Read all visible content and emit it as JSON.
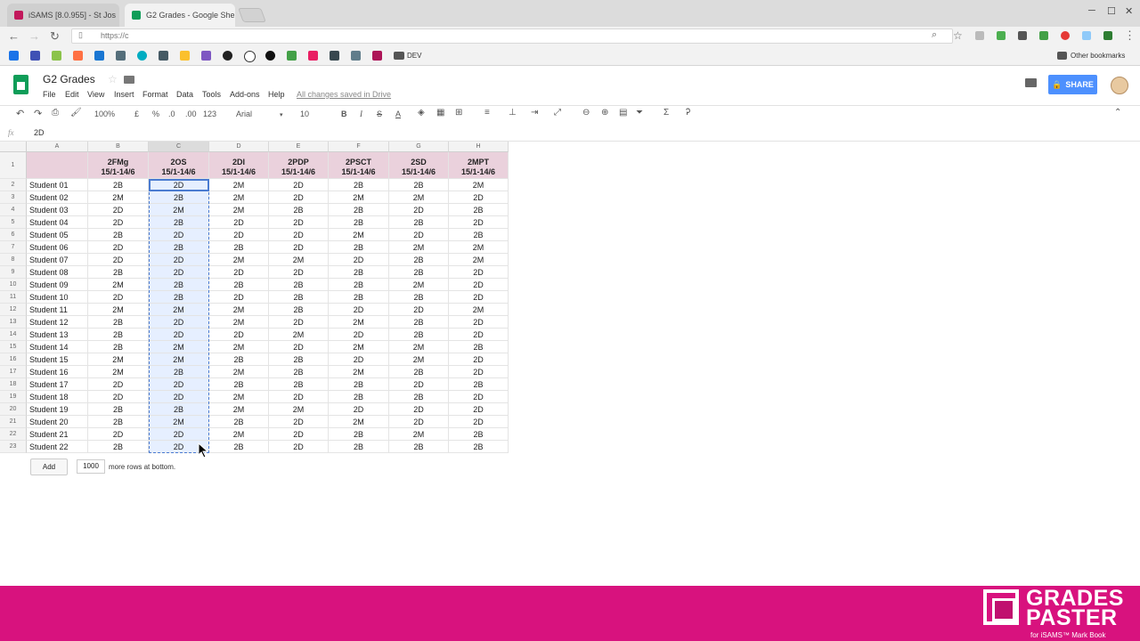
{
  "browser": {
    "tabs": [
      {
        "title": "iSAMS [8.0.955] - St Jos",
        "favicon_color": "#c2185b"
      },
      {
        "title": "G2 Grades - Google She",
        "favicon_color": "#0f9d58"
      }
    ],
    "url": "https://c",
    "bookmarks_other": "Other bookmarks",
    "bookmark_dev": "DEV"
  },
  "doc": {
    "title": "G2 Grades",
    "menus": [
      "File",
      "Edit",
      "View",
      "Insert",
      "Format",
      "Data",
      "Tools",
      "Add-ons",
      "Help"
    ],
    "saved_status": "All changes saved in Drive",
    "share_label": "SHARE"
  },
  "toolbar": {
    "zoom": "100%",
    "currency": "£",
    "percent": "%",
    "dec_less": ".0",
    "dec_more": ".00",
    "format_more": "123",
    "font": "Arial",
    "font_size": "10",
    "bold": "B",
    "italic": "I",
    "strike": "S",
    "text_color": "A"
  },
  "formula_bar": {
    "fx": "fx",
    "value": "2D"
  },
  "grid": {
    "col_letters": [
      "A",
      "B",
      "C",
      "D",
      "E",
      "F",
      "G",
      "H"
    ],
    "headers": [
      {
        "code": "",
        "dates": ""
      },
      {
        "code": "2FMg",
        "dates": "15/1-14/6"
      },
      {
        "code": "2OS",
        "dates": "15/1-14/6"
      },
      {
        "code": "2DI",
        "dates": "15/1-14/6"
      },
      {
        "code": "2PDP",
        "dates": "15/1-14/6"
      },
      {
        "code": "2PSCT",
        "dates": "15/1-14/6"
      },
      {
        "code": "2SD",
        "dates": "15/1-14/6"
      },
      {
        "code": "2MPT",
        "dates": "15/1-14/6"
      }
    ],
    "rows": [
      [
        "Student 01",
        "2B",
        "2D",
        "2M",
        "2D",
        "2B",
        "2B",
        "2M"
      ],
      [
        "Student 02",
        "2M",
        "2B",
        "2M",
        "2D",
        "2M",
        "2M",
        "2D"
      ],
      [
        "Student 03",
        "2D",
        "2M",
        "2M",
        "2B",
        "2B",
        "2D",
        "2B"
      ],
      [
        "Student 04",
        "2D",
        "2B",
        "2D",
        "2D",
        "2B",
        "2B",
        "2D"
      ],
      [
        "Student 05",
        "2B",
        "2D",
        "2D",
        "2D",
        "2M",
        "2D",
        "2B"
      ],
      [
        "Student 06",
        "2D",
        "2B",
        "2B",
        "2D",
        "2B",
        "2M",
        "2M"
      ],
      [
        "Student 07",
        "2D",
        "2D",
        "2M",
        "2M",
        "2D",
        "2B",
        "2M"
      ],
      [
        "Student 08",
        "2B",
        "2D",
        "2D",
        "2D",
        "2B",
        "2B",
        "2D"
      ],
      [
        "Student 09",
        "2M",
        "2B",
        "2B",
        "2B",
        "2B",
        "2M",
        "2D"
      ],
      [
        "Student 10",
        "2D",
        "2B",
        "2D",
        "2B",
        "2B",
        "2B",
        "2D"
      ],
      [
        "Student 11",
        "2M",
        "2M",
        "2M",
        "2B",
        "2D",
        "2D",
        "2M"
      ],
      [
        "Student 12",
        "2B",
        "2D",
        "2M",
        "2D",
        "2M",
        "2B",
        "2D"
      ],
      [
        "Student 13",
        "2B",
        "2D",
        "2D",
        "2M",
        "2D",
        "2B",
        "2D"
      ],
      [
        "Student 14",
        "2B",
        "2M",
        "2M",
        "2D",
        "2M",
        "2M",
        "2B"
      ],
      [
        "Student 15",
        "2M",
        "2M",
        "2B",
        "2B",
        "2D",
        "2M",
        "2D"
      ],
      [
        "Student 16",
        "2M",
        "2B",
        "2M",
        "2B",
        "2M",
        "2B",
        "2D"
      ],
      [
        "Student 17",
        "2D",
        "2D",
        "2B",
        "2B",
        "2B",
        "2D",
        "2B"
      ],
      [
        "Student 18",
        "2D",
        "2D",
        "2M",
        "2D",
        "2B",
        "2B",
        "2D"
      ],
      [
        "Student 19",
        "2B",
        "2B",
        "2M",
        "2M",
        "2D",
        "2D",
        "2D"
      ],
      [
        "Student 20",
        "2B",
        "2M",
        "2B",
        "2D",
        "2M",
        "2D",
        "2D"
      ],
      [
        "Student 21",
        "2D",
        "2D",
        "2M",
        "2D",
        "2B",
        "2M",
        "2B"
      ],
      [
        "Student 22",
        "2B",
        "2D",
        "2B",
        "2D",
        "2B",
        "2B",
        "2B"
      ]
    ],
    "add_button": "Add",
    "add_rows_value": "1000",
    "add_rows_text": "more rows at bottom."
  },
  "banner": {
    "line1": "GRADES",
    "line2": "PASTER",
    "subtitle": "for iSAMS™ Mark Book",
    "color": "#d8127e"
  }
}
